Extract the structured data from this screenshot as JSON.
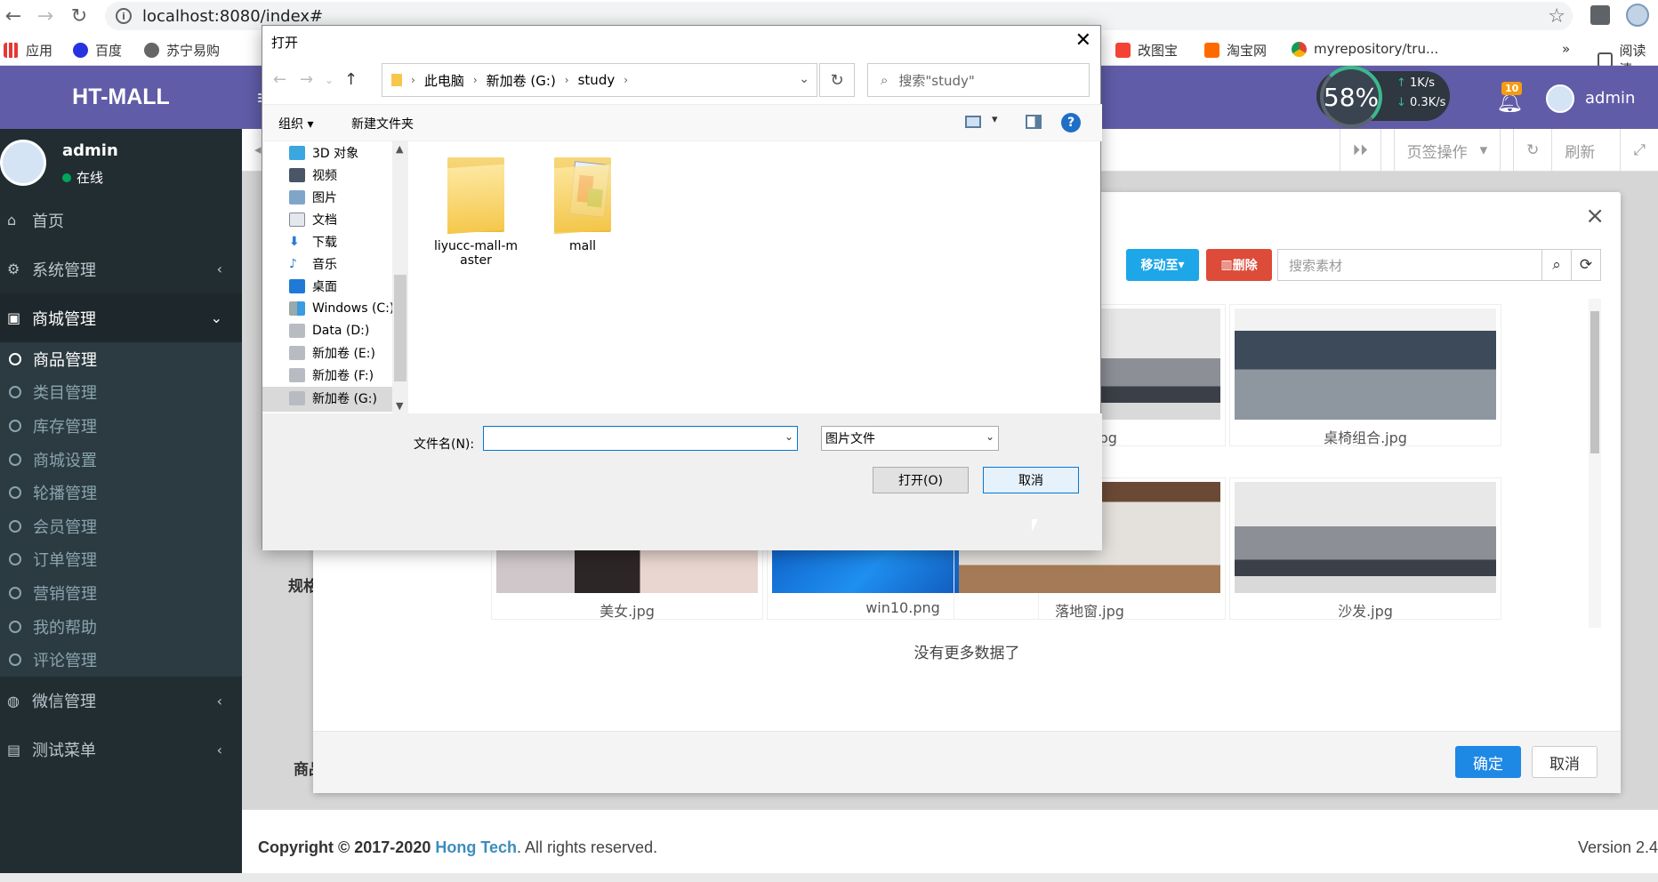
{
  "browser": {
    "url": "localhost:8080/index#",
    "bookmarks": [
      "应用",
      "百度",
      "苏宁易购",
      "改图宝",
      "淘宝网",
      "myrepository/tru...",
      "阅读清"
    ]
  },
  "speed": {
    "percent": "58%",
    "up": "1K/s",
    "down": "0.3K/s"
  },
  "header": {
    "logo": "HT-MALL",
    "notif_count": "10",
    "user": "admin"
  },
  "sidebar": {
    "user": "admin",
    "status": "在线",
    "items": [
      {
        "label": "首页"
      },
      {
        "label": "系统管理"
      },
      {
        "label": "商城管理"
      }
    ],
    "sub_items": [
      "商品管理",
      "类目管理",
      "库存管理",
      "商城设置",
      "轮播管理",
      "会员管理",
      "订单管理",
      "营销管理",
      "我的帮助",
      "评论管理"
    ],
    "bottom_items": [
      {
        "label": "微信管理"
      },
      {
        "label": "测试菜单"
      }
    ]
  },
  "tabbar": {
    "page_ops": "页签操作",
    "refresh": "刷新"
  },
  "content": {
    "label_spec": "规格",
    "label_goods": "商品"
  },
  "material": {
    "move_btn": "移动至",
    "delete_btn": "删除",
    "search_placeholder": "搜索素材",
    "images": [
      "沙发.jpg",
      "桌椅组合.jpg",
      "美女.jpg",
      "win10.png",
      "落地窗.jpg",
      "沙发.jpg"
    ],
    "no_more": "没有更多数据了",
    "ok": "确定",
    "cancel": "取消"
  },
  "footer": {
    "copyright": "Copyright © 2017-2020 ",
    "company": "Hong Tech",
    "rights": ". All rights reserved.",
    "version": "Version 2.4"
  },
  "dialog": {
    "title": "打开",
    "path": [
      "此电脑",
      "新加卷 (G:)",
      "study"
    ],
    "search_placeholder": "搜索\"study\"",
    "organize": "组织",
    "new_folder": "新建文件夹",
    "tree": [
      "3D 对象",
      "视频",
      "图片",
      "文档",
      "下载",
      "音乐",
      "桌面",
      "Windows (C:)",
      "Data (D:)",
      "新加卷 (E:)",
      "新加卷 (F:)",
      "新加卷 (G:)"
    ],
    "files": [
      "liyucc-mall-master",
      "mall"
    ],
    "filename_label": "文件名(N):",
    "filename_value": "",
    "filetype": "图片文件",
    "open_btn": "打开(O)",
    "cancel_btn": "取消"
  }
}
